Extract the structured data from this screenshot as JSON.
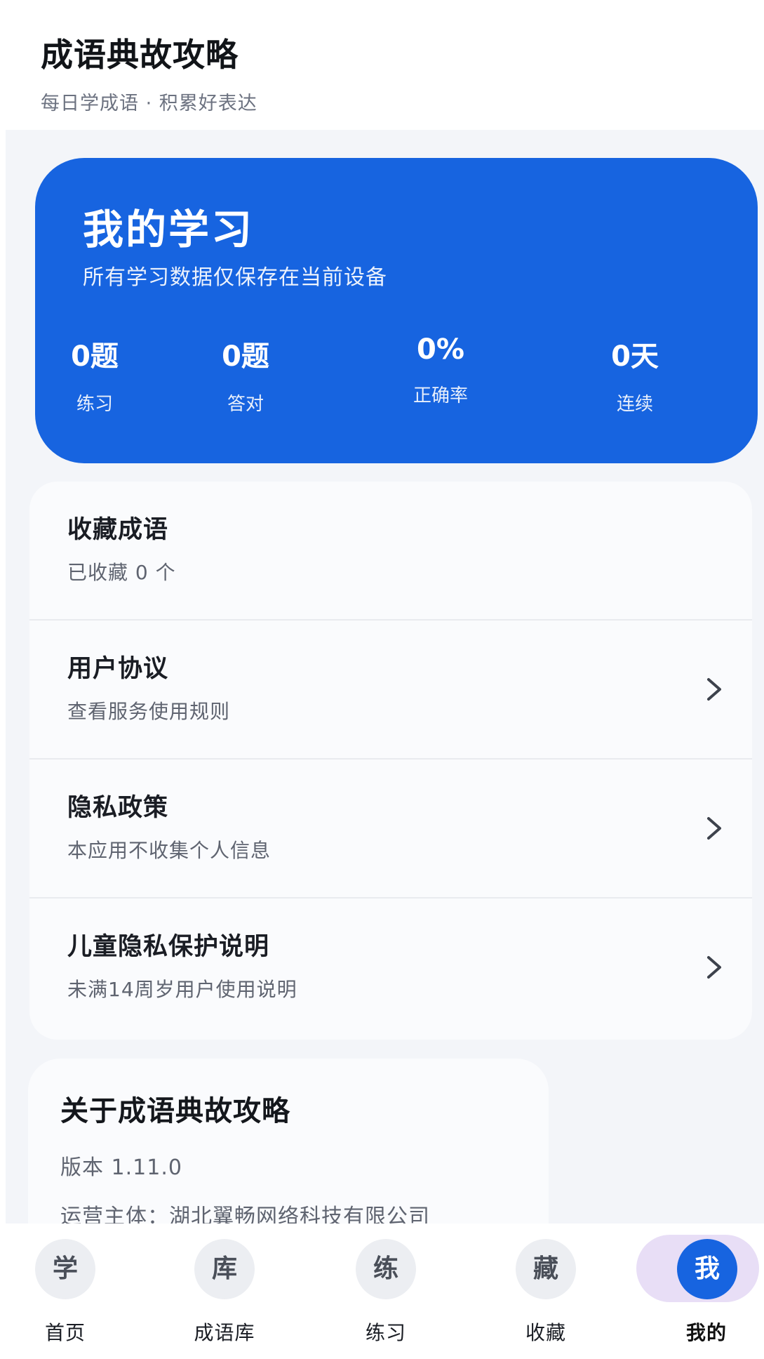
{
  "header": {
    "title": "成语典故攻略",
    "subtitle": "每日学成语 · 积累好表达"
  },
  "hero": {
    "title": "我的学习",
    "subtitle": "所有学习数据仅保存在当前设备",
    "stats": [
      {
        "value": "0题",
        "label": "练习"
      },
      {
        "value": "0题",
        "label": "答对"
      },
      {
        "value": "0%",
        "label": "正确率"
      },
      {
        "value": "0天",
        "label": "连续"
      }
    ]
  },
  "menu": {
    "items": [
      {
        "title": "收藏成语",
        "desc": "已收藏 0 个"
      },
      {
        "title": "用户协议",
        "desc": "查看服务使用规则"
      },
      {
        "title": "隐私政策",
        "desc": "本应用不收集个人信息"
      },
      {
        "title": "儿童隐私保护说明",
        "desc": "未满14周岁用户使用说明"
      }
    ]
  },
  "about": {
    "title": "关于成语典故攻略",
    "version": "版本 1.11.0",
    "company": "运营主体：湖北翼畅网络科技有限公司"
  },
  "tabs": [
    {
      "icon": "学",
      "label": "首页"
    },
    {
      "icon": "库",
      "label": "成语库"
    },
    {
      "icon": "练",
      "label": "练习"
    },
    {
      "icon": "藏",
      "label": "收藏"
    },
    {
      "icon": "我",
      "label": "我的"
    }
  ],
  "colors": {
    "accent": "#1764e0",
    "active_tab_bg": "#e8def6",
    "background": "#f3f5f9"
  }
}
